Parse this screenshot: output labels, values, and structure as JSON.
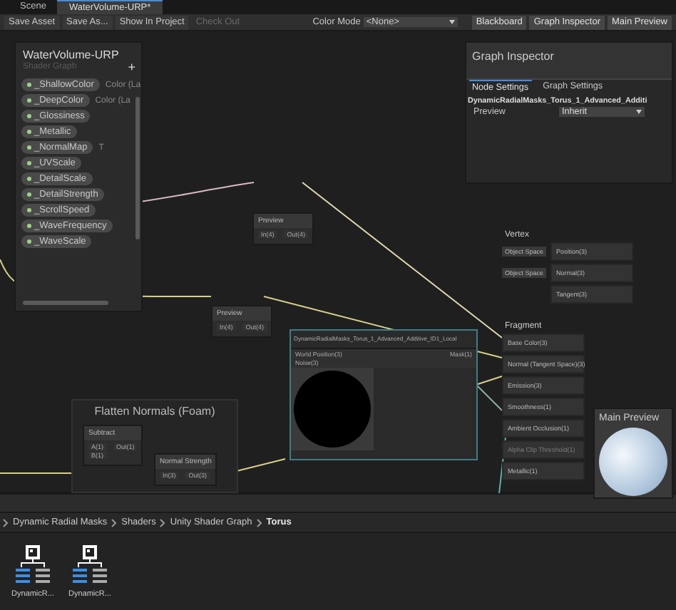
{
  "tabs": [
    {
      "label": "Scene",
      "selected": false
    },
    {
      "label": "WaterVolume-URP*",
      "selected": true
    }
  ],
  "toolbar": {
    "buttons": [
      {
        "label": "Save Asset",
        "disabled": false
      },
      {
        "label": "Save As...",
        "disabled": false
      },
      {
        "label": "Show In Project",
        "disabled": false
      },
      {
        "label": "Check Out",
        "disabled": true
      }
    ],
    "color_mode": {
      "label": "Color Mode",
      "value": "<None>"
    },
    "toggles": [
      {
        "label": "Blackboard",
        "on": true
      },
      {
        "label": "Graph Inspector",
        "on": true
      },
      {
        "label": "Main Preview",
        "on": true
      }
    ]
  },
  "blackboard": {
    "title": "WaterVolume-URP",
    "subtitle": "Shader Graph",
    "add": "+",
    "properties": [
      {
        "name": "_ShallowColor",
        "type": "Color (La"
      },
      {
        "name": "_DeepColor",
        "type": "Color (La"
      },
      {
        "name": "_Glossiness"
      },
      {
        "name": "_Metallic"
      },
      {
        "name": "_NormalMap",
        "type": "T"
      },
      {
        "name": "_UVScale"
      },
      {
        "name": "_DetailScale"
      },
      {
        "name": "_DetailStrength"
      },
      {
        "name": "_ScrollSpeed"
      },
      {
        "name": "_WaveFrequency"
      },
      {
        "name": "_WaveScale"
      }
    ]
  },
  "graph_inspector": {
    "title": "Graph Inspector",
    "tabs": [
      {
        "label": "Node Settings",
        "selected": true
      },
      {
        "label": "Graph Settings",
        "selected": false
      }
    ],
    "node_title": "DynamicRadialMasks_Torus_1_Advanced_Additi",
    "fields": [
      {
        "label": "Preview",
        "value": "Inherit"
      }
    ]
  },
  "preview_nodes": [
    {
      "title": "Preview",
      "input": "In(4)",
      "output": "Out(4)"
    },
    {
      "title": "Preview",
      "input": "In(4)",
      "output": "Out(4)"
    }
  ],
  "vertex": {
    "title": "Vertex",
    "ports": [
      {
        "label": "Position(3)",
        "space": "Object Space"
      },
      {
        "label": "Normal(3)",
        "space": "Object Space"
      },
      {
        "label": "Tangent(3)"
      }
    ]
  },
  "fragment": {
    "title": "Fragment",
    "ports": [
      {
        "label": "Base Color(3)",
        "disabled": false
      },
      {
        "label": "Normal (Tangent Space)(3)",
        "disabled": false
      },
      {
        "label": "Emission(3)",
        "disabled": false
      },
      {
        "label": "Smoothness(1)",
        "disabled": false
      },
      {
        "label": "Ambient Occlusion(1)",
        "disabled": false
      },
      {
        "label": "Alpha Clip Threshold(1)",
        "disabled": true
      },
      {
        "label": "Metallic(1)",
        "disabled": false
      }
    ]
  },
  "subgraph_node": {
    "title": "DynamicRadialMasks_Torus_1_Advanced_Additive_ID1_Local",
    "inputs": [
      "World Position(3)",
      "Noise(3)"
    ],
    "output": "Mask(1)"
  },
  "main_preview": {
    "title": "Main Preview"
  },
  "group": {
    "title": "Flatten Normals (Foam)",
    "nodes": [
      {
        "title": "Subtract",
        "inputs": [
          "A(1)",
          "B(1)"
        ],
        "output": "Out(1)"
      },
      {
        "title": "Normal Strength",
        "inputs": [
          "In(3)"
        ],
        "output": "Out(3)"
      }
    ]
  },
  "breadcrumb": [
    {
      "label": "Dynamic Radial Masks",
      "current": false
    },
    {
      "label": "Shaders",
      "current": false
    },
    {
      "label": "Unity Shader Graph",
      "current": false
    },
    {
      "label": "Torus",
      "current": true
    }
  ],
  "assets": [
    {
      "name": "DynamicR..."
    },
    {
      "name": "DynamicR..."
    }
  ]
}
